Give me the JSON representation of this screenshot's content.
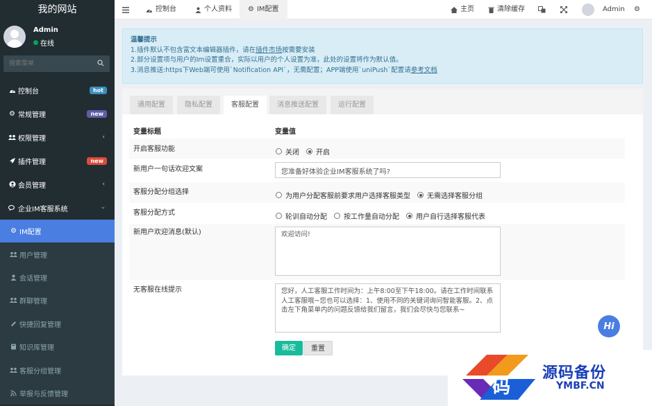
{
  "app": {
    "title": "我的网站"
  },
  "user": {
    "name": "Admin",
    "status": "在线"
  },
  "sidebar": {
    "search_placeholder": "搜索菜单",
    "items": [
      {
        "label": "控制台",
        "icon": "dashboard-icon",
        "badge": "hot",
        "badge_color": "#3c8dbc"
      },
      {
        "label": "常规管理",
        "icon": "cogs-icon",
        "badge": "new",
        "badge_color": "#605ca8"
      },
      {
        "label": "权限管理",
        "icon": "users-icon"
      },
      {
        "label": "插件管理",
        "icon": "rocket-icon",
        "badge": "new",
        "badge_color": "#dd4b39"
      },
      {
        "label": "会员管理",
        "icon": "user-circle-icon"
      },
      {
        "label": "企业IM客服系统",
        "icon": "comments-icon"
      }
    ],
    "sub_items": [
      {
        "label": "IM配置",
        "icon": "cogs-icon",
        "active": true
      },
      {
        "label": "用户管理",
        "icon": "users-icon"
      },
      {
        "label": "会话管理",
        "icon": "user-icon"
      },
      {
        "label": "群聊管理",
        "icon": "users-icon"
      },
      {
        "label": "快捷回复管理",
        "icon": "pencil-icon"
      },
      {
        "label": "知识库管理",
        "icon": "book-icon"
      },
      {
        "label": "客服分组管理",
        "icon": "users-icon"
      },
      {
        "label": "举报与反馈管理",
        "icon": "rss-icon"
      }
    ]
  },
  "topbar": {
    "tabs": [
      {
        "label": "控制台",
        "icon": "dashboard-icon"
      },
      {
        "label": "个人资料",
        "icon": "user-icon"
      },
      {
        "label": "IM配置",
        "icon": "cogs-icon"
      }
    ],
    "home": "主页",
    "clear_cache": "清除缓存",
    "admin": "Admin"
  },
  "alert": {
    "title": "温馨提示",
    "line1_a": "1.插件默认不包含富文本编辑器插件，请在",
    "line1_link": "插件市场",
    "line1_b": "按需要安装",
    "line2": "2.部分设置项与用户的Im设置重合，实际以用户的个人设置为准，此处的设置将作为默认值。",
    "line3_a": "3.消息推送:https下Web端可使用`Notification API`，无需配置；APP端使用`uniPush`配置请",
    "line3_link": "参考文档"
  },
  "tabs": [
    "通用配置",
    "隐私配置",
    "客服配置",
    "消息推送配置",
    "运行配置"
  ],
  "form": {
    "col_title": "变量标题",
    "col_value": "变量值",
    "rows": {
      "enable": {
        "label": "开启客服功能",
        "options": [
          "关闭",
          "开启"
        ]
      },
      "welcome": {
        "label": "新用户一句话欢迎文案",
        "value": "您准备好体验企业IM客服系统了吗?"
      },
      "group_select": {
        "label": "客服分配分组选择",
        "options": [
          "为用户分配客服前要求用户选择客服类型",
          "无需选择客服分组"
        ]
      },
      "assign_mode": {
        "label": "客服分配方式",
        "options": [
          "轮训自动分配",
          "按工作量自动分配",
          "用户自行选择客服代表"
        ]
      },
      "welcome_msg": {
        "label": "新用户欢迎消息(默认)",
        "value": "欢迎访问!"
      },
      "offline_tip": {
        "label": "无客服在线提示",
        "value": "您好，人工客服工作时间为：上午8:00至下午18:00。请在工作时间联系人工客服哦~您也可以选择：1、使用不同的关键词询问智能客服。2、点击左下角菜单内的问题反馈给我们留言，我们会尽快与您联系~"
      }
    },
    "submit": "确定",
    "reset": "重置"
  },
  "chat_bubble": "Hi",
  "watermark": {
    "char": "码",
    "title": "源码备份",
    "sub": "YMBF.CN"
  }
}
